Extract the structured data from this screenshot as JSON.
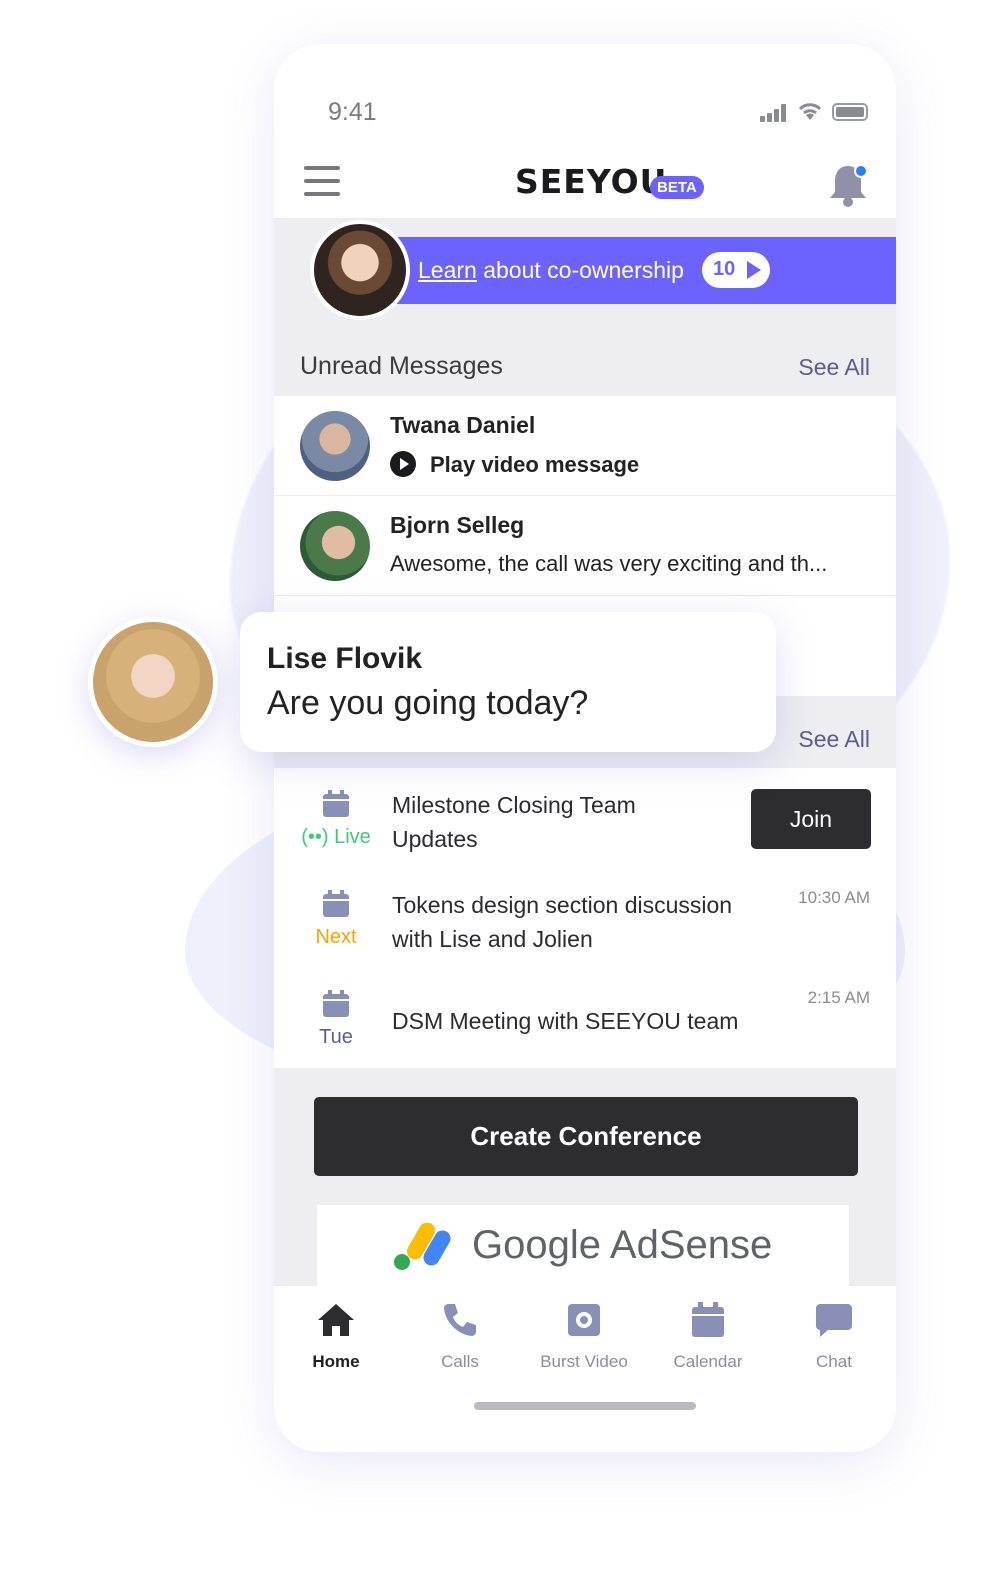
{
  "status_bar": {
    "time": "9:41"
  },
  "header": {
    "logo": "SEEYOU",
    "badge": "BETA"
  },
  "banner": {
    "link_word": "Learn",
    "text_rest": " about co-ownership",
    "count": "10"
  },
  "unread": {
    "heading": "Unread Messages",
    "see_all": "See All",
    "messages": [
      {
        "name": "Twana Daniel",
        "preview": "Play video message"
      },
      {
        "name": "Bjorn Selleg",
        "preview": "Awesome, the call was very exciting and th..."
      }
    ]
  },
  "meetings": {
    "see_all": "See All",
    "items": [
      {
        "tag": "Live",
        "title_line1": "Milestone Closing Team",
        "title_line2": "Updates",
        "action": "Join"
      },
      {
        "tag": "Next",
        "title_line1": "Tokens design section discussion",
        "title_line2": "with Lise and Jolien",
        "time": "10:30 AM"
      },
      {
        "tag": "Tue",
        "title_line1": "DSM Meeting with SEEYOU team",
        "time": "2:15 AM"
      }
    ]
  },
  "create_button": "Create Conference",
  "ad": {
    "text": "Google AdSense"
  },
  "nav": [
    {
      "label": "Home",
      "icon": "home-icon"
    },
    {
      "label": "Calls",
      "icon": "phone-icon"
    },
    {
      "label": "Burst Video",
      "icon": "camera-icon"
    },
    {
      "label": "Calendar",
      "icon": "calendar-icon"
    },
    {
      "label": "Chat",
      "icon": "chat-icon"
    }
  ],
  "notification": {
    "name": "Lise Flovik",
    "text": "Are you going today?"
  },
  "colors": {
    "accent": "#6c63ff",
    "live": "#3ec97a",
    "next": "#f5a300",
    "dark": "#2d2d30"
  }
}
